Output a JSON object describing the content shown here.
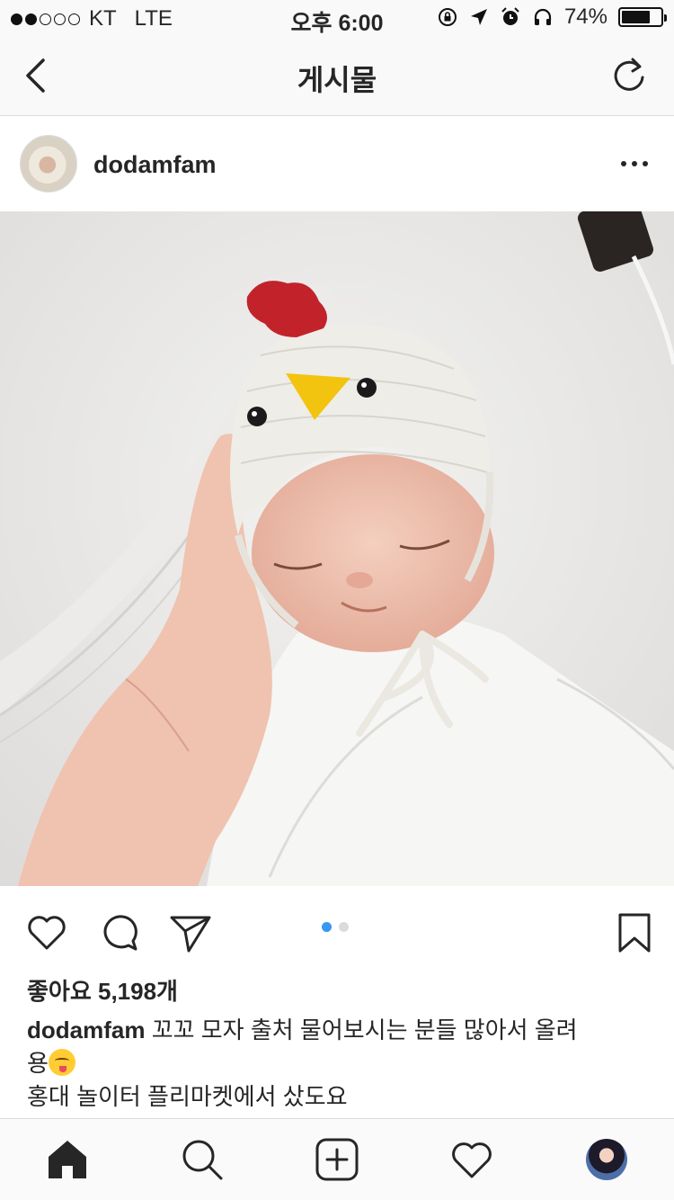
{
  "status_bar": {
    "carrier": "KT",
    "network": "LTE",
    "time": "오후 6:00",
    "battery": "74%",
    "battery_level": 0.74,
    "signal_bars": 2
  },
  "nav": {
    "title": "게시물"
  },
  "post": {
    "username": "dodamfam",
    "likes": "좋아요 5,198개",
    "caption_user": "dodamfam",
    "caption_line1": "꼬꼬 모자 출처 물어보시는 분들 많아서 올려",
    "caption_line2": "용",
    "caption_line3": "홍대 놀이터 플리마켓에서 샀도요",
    "carousel_pages": 2,
    "carousel_active": 1
  },
  "icons": {
    "back": "chevron-left-icon",
    "refresh": "refresh-icon",
    "more": "more-icon",
    "like": "heart-icon",
    "comment": "comment-icon",
    "share": "send-icon",
    "save": "bookmark-icon",
    "home": "home-icon",
    "search": "search-icon",
    "add": "add-icon",
    "activity": "heart-icon",
    "profile": "profile-avatar"
  },
  "colors": {
    "accent": "#3897f0",
    "text": "#262626",
    "divider": "#dbdbdb"
  }
}
